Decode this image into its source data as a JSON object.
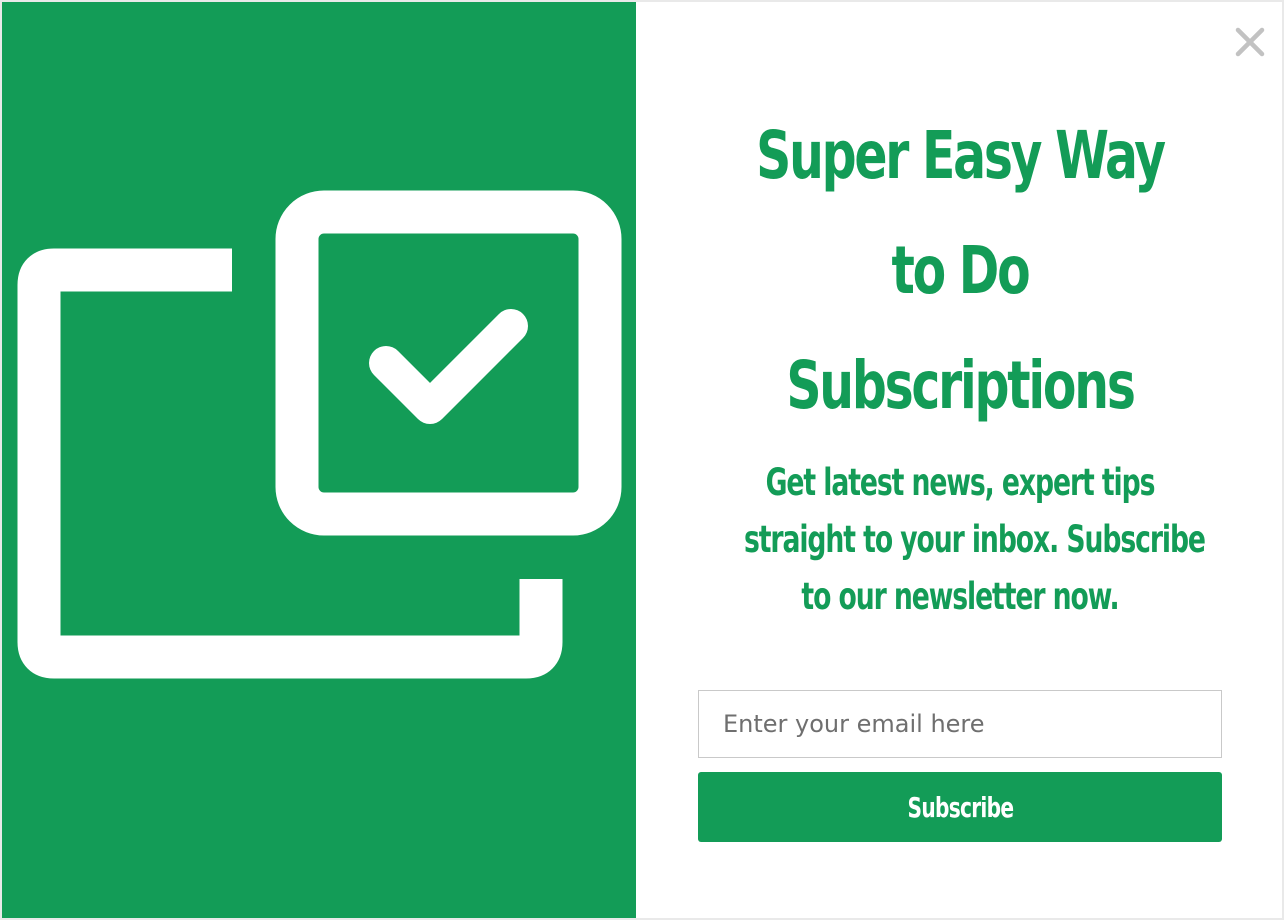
{
  "popup": {
    "headline_lines": [
      "Super Easy Way",
      "to Do",
      "Subscriptions"
    ],
    "subtext_lines": [
      "Get latest news, expert tips",
      "straight to your inbox. Subscribe",
      "to our newsletter now."
    ],
    "email_placeholder": "Enter your email here",
    "subscribe_label": "Subscribe",
    "close_icon": "close-icon",
    "illustration_icon": "checkbox-window-icon"
  },
  "colors": {
    "brand_green": "#139c57",
    "background": "#ffffff",
    "close_gray": "#c2c2c2",
    "input_border": "#c9c9c9"
  }
}
